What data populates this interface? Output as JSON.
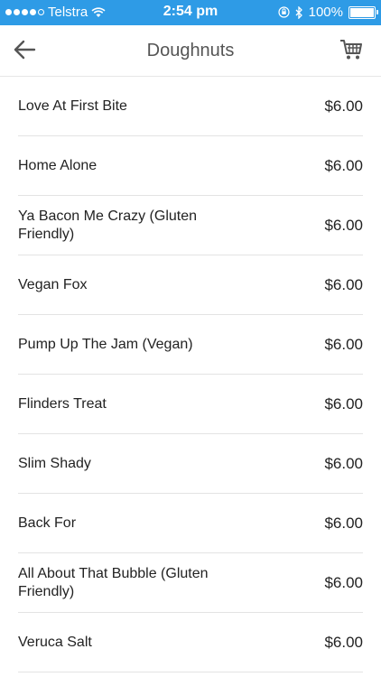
{
  "status_bar": {
    "carrier": "Telstra",
    "time": "2:54 pm",
    "battery": "100%",
    "battery_level": 1.0,
    "signal_bars_filled": 4,
    "signal_bars_total": 5
  },
  "header": {
    "title": "Doughnuts",
    "back_icon": "arrow-left-icon",
    "cart_icon": "cart-icon"
  },
  "colors": {
    "status_bar_bg": "#2e9be6",
    "divider": "#e3e3e3"
  },
  "items": [
    {
      "name": "Love At First Bite",
      "price": "$6.00"
    },
    {
      "name": "Home Alone",
      "price": "$6.00"
    },
    {
      "name": "Ya Bacon Me Crazy (Gluten Friendly)",
      "price": "$6.00"
    },
    {
      "name": "Vegan Fox",
      "price": "$6.00"
    },
    {
      "name": "Pump Up The Jam (Vegan)",
      "price": "$6.00"
    },
    {
      "name": "Flinders Treat",
      "price": "$6.00"
    },
    {
      "name": "Slim Shady",
      "price": "$6.00"
    },
    {
      "name": "Back For",
      "price": "$6.00"
    },
    {
      "name": "All About That Bubble (Gluten Friendly)",
      "price": "$6.00"
    },
    {
      "name": "Veruca Salt",
      "price": "$6.00"
    }
  ]
}
